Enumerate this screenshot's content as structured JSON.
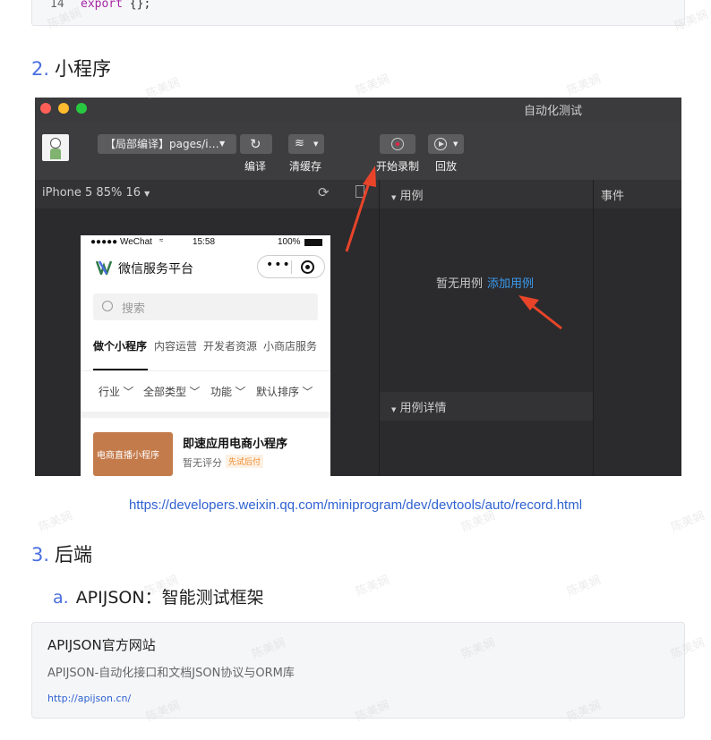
{
  "code": {
    "line_number": "14",
    "keyword": "export",
    "rest": " {};"
  },
  "section2": {
    "number": "2.",
    "title": "小程序"
  },
  "devtools": {
    "window_title": "自动化测试",
    "compile_mode": "【局部编译】pages/i…",
    "buttons": {
      "compile": "编译",
      "clear_cache": "清缓存",
      "start_record": "开始录制",
      "replay": "回放"
    },
    "device": "iPhone 5 85% 16",
    "panels": {
      "cases": "用例",
      "events": "事件",
      "case_details": "用例详情"
    },
    "empty_text": "暂无用例",
    "add_case": "添加用例",
    "phone": {
      "carrier": "●●●●● WeChat",
      "time": "15:58",
      "battery": "100%",
      "nav_title": "微信服务平台",
      "search_placeholder": "搜索",
      "tabs": [
        "做个小程序",
        "内容运营",
        "开发者资源",
        "小商店服务"
      ],
      "filters": [
        "行业",
        "全部类型",
        "功能",
        "默认排序"
      ],
      "card": {
        "image_caption": "电商直播小程序",
        "title": "即速应用电商小程序",
        "rating": "暂无评分",
        "badge": "先试后付"
      }
    }
  },
  "link_url": "https://developers.weixin.qq.com/miniprogram/dev/devtools/auto/record.html",
  "section3": {
    "number": "3.",
    "title": "后端"
  },
  "section3a": {
    "number": "a.",
    "title": "APIJSON：智能测试框架"
  },
  "link_card": {
    "title": "APIJSON官方网站",
    "description": "APIJSON-自动化接口和文档JSON协议与ORM库",
    "url": "http://apijson.cn/"
  },
  "watermark": "陈美娴",
  "colors": {
    "accent": "#4a6ee0",
    "link": "#2f62d1",
    "arrow": "#e8442a",
    "devtools_link": "#3a9aef"
  }
}
